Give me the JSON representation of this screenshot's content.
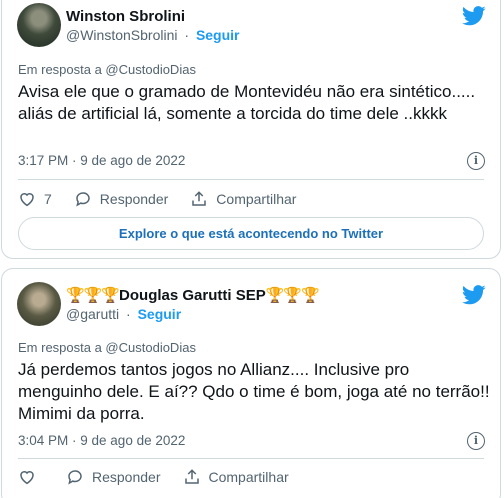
{
  "colors": {
    "accent": "#1d9bf0",
    "muted": "#536471",
    "text": "#0f1419",
    "border": "#cfd9de"
  },
  "tweets": [
    {
      "name": "Winston Sbrolini",
      "handle": "@WinstonSbrolini",
      "separator": "·",
      "follow": "Seguir",
      "reply_to": "Em resposta a @CustodioDias",
      "text": "Avisa ele que o gramado de Montevidéu não era sintético..... aliás de artificial lá, somente a torcida do time dele ..kkkk",
      "time": "3:17 PM · 9 de ago de 2022",
      "likes": "7",
      "reply_label": "Responder",
      "share_label": "Compartilhar",
      "explore": "Explore o que está acontecendo no Twitter",
      "icon": "twitter-bird-icon"
    },
    {
      "name": "Douglas Garutti SEP",
      "name_prefix": "🏆🏆🏆",
      "name_suffix": "🏆🏆🏆",
      "handle": "@garutti",
      "separator": "·",
      "follow": "Seguir",
      "reply_to": "Em resposta a @CustodioDias",
      "text": "Já perdemos tantos jogos no Allianz.... Inclusive pro menguinho dele. E aí?? Qdo o time é bom, joga até no terrão!! Mimimi da porra.",
      "time": "3:04 PM · 9 de ago de 2022",
      "reply_label": "Responder",
      "share_label": "Compartilhar",
      "icon": "twitter-bird-icon"
    }
  ]
}
